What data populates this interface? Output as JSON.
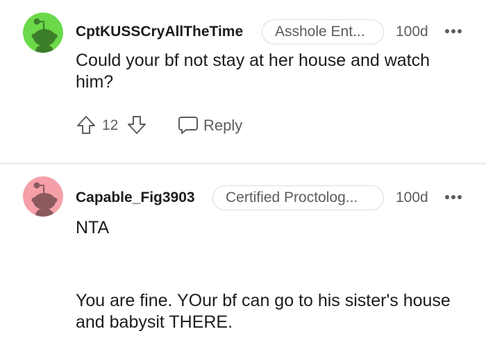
{
  "comments": [
    {
      "username": "CptKUSSCryAllTheTime",
      "flair": "Asshole Ent...",
      "age": "100d",
      "body": "Could your bf not stay at her house and watch him?",
      "votes": "12",
      "reply_label": "Reply",
      "avatar_color": "#6bd94a"
    },
    {
      "username": "Capable_Fig3903",
      "flair": "Certified Proctolog...",
      "age": "100d",
      "body_line1": "NTA",
      "body_line2": "You are fine. YOur bf can go to his sister's house and babysit THERE.",
      "avatar_color": "#f5a0a8"
    }
  ]
}
